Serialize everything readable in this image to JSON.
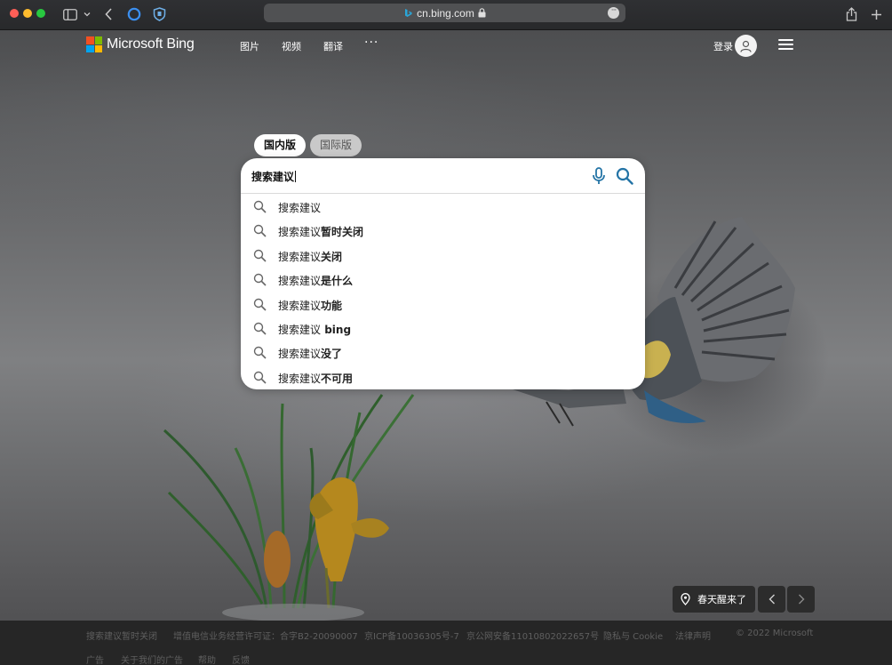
{
  "browser": {
    "url": "cn.bing.com",
    "icons": [
      "sidebar-icon",
      "chevron-down-icon",
      "back-icon",
      "cortana-icon",
      "shield-icon",
      "lock-icon",
      "more-icon",
      "share-icon",
      "new-tab-icon"
    ]
  },
  "header": {
    "brand": "Microsoft Bing",
    "nav": [
      "图片",
      "视频",
      "翻译"
    ],
    "more": "···",
    "login": "登录",
    "logo_colors": [
      "#f25022",
      "#7fba00",
      "#00a4ef",
      "#ffb900"
    ]
  },
  "search": {
    "tabs": [
      "国内版",
      "国际版"
    ],
    "active_tab": "国内版",
    "query": "搜索建议",
    "suggestions": [
      {
        "prefix": "搜索建议",
        "suffix": ""
      },
      {
        "prefix": "搜索建议",
        "suffix": "暂时关闭"
      },
      {
        "prefix": "搜索建议",
        "suffix": "关闭"
      },
      {
        "prefix": "搜索建议",
        "suffix": "是什么"
      },
      {
        "prefix": "搜索建议",
        "suffix": "功能"
      },
      {
        "prefix": "搜索建议",
        "suffix": " bing"
      },
      {
        "prefix": "搜索建议",
        "suffix": "没了"
      },
      {
        "prefix": "搜索建议",
        "suffix": "不可用"
      }
    ],
    "accent_color": "#2474a6"
  },
  "wallpaper": {
    "story_label": "春天醒来了"
  },
  "footer": {
    "row1": [
      "搜索建议暂时关闭",
      "增值电信业务经营许可证：合字B2-20090007",
      "京ICP备10036305号-7",
      "京公网安备11010802022657号",
      "隐私与 Cookie",
      "法律声明",
      "© 2022 Microsoft"
    ],
    "row2": [
      "广告",
      "关于我们的广告",
      "帮助",
      "反馈"
    ]
  }
}
